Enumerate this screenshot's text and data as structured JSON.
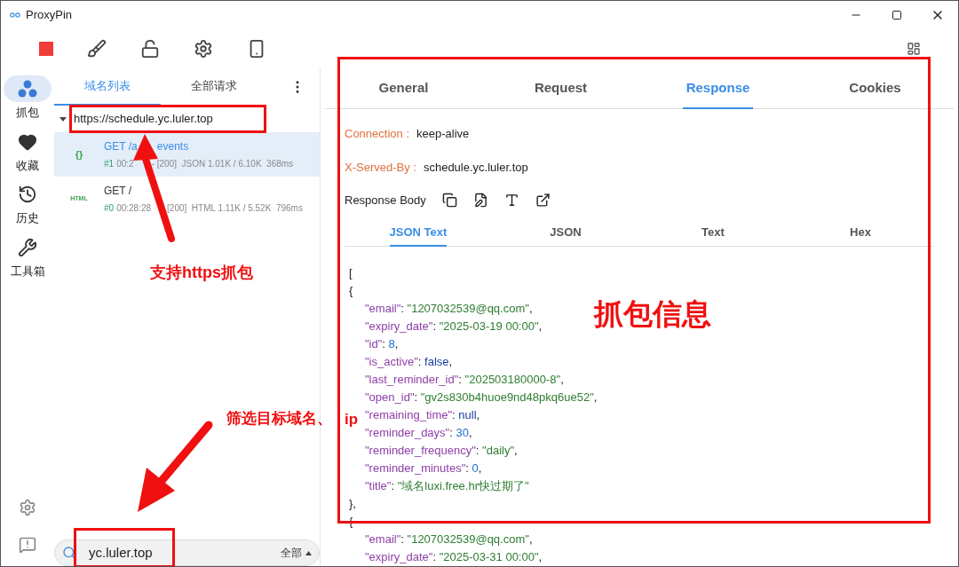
{
  "window": {
    "title": "ProxyPin"
  },
  "nav": [
    {
      "label": "抓包",
      "selected": true
    },
    {
      "label": "收藏",
      "selected": false
    },
    {
      "label": "历史",
      "selected": false
    },
    {
      "label": "工具箱",
      "selected": false
    }
  ],
  "list_tabs": [
    {
      "label": "域名列表",
      "selected": true
    },
    {
      "label": "全部请求",
      "selected": false
    }
  ],
  "domain": {
    "url": "https://schedule.yc.luler.top",
    "expanded": true
  },
  "requests": [
    {
      "kind": "json",
      "icon_text": "{}",
      "title": [
        "GET /a",
        "events"
      ],
      "number": "#1",
      "meta": [
        "00:2",
        "- [200]  JSON 1.01K / 6.10K  368ms"
      ],
      "selected": true
    },
    {
      "kind": "html",
      "icon_text": "HTML",
      "title": [
        "GET /"
      ],
      "number": "#0",
      "meta": [
        "00:28:28",
        "[200]  HTML 1.11K / 5.52K  796ms"
      ],
      "selected": false
    }
  ],
  "search": {
    "value": "yc.luler.top",
    "filter": "全部"
  },
  "detail_tabs": [
    {
      "label": "General",
      "selected": false
    },
    {
      "label": "Request",
      "selected": false
    },
    {
      "label": "Response",
      "selected": true
    },
    {
      "label": "Cookies",
      "selected": false
    }
  ],
  "headers": [
    {
      "name": "Connection :",
      "value": "keep-alive"
    },
    {
      "name": "X-Served-By :",
      "value": "schedule.yc.luler.top"
    }
  ],
  "body_label": "Response Body",
  "body_tabs": [
    {
      "label": "JSON Text",
      "selected": true
    },
    {
      "label": "JSON",
      "selected": false
    },
    {
      "label": "Text",
      "selected": false
    },
    {
      "label": "Hex",
      "selected": false
    }
  ],
  "body": {
    "open": "[",
    "children": [
      {
        "open": "{",
        "close": "},",
        "entries": [
          {
            "key": "\"email\"",
            "colon": ": ",
            "value": "\"1207032539@qq.com\"",
            "kind": "string",
            "comma": ","
          },
          {
            "key": "\"expiry_date\"",
            "colon": ": ",
            "value": "\"2025-03-19 00:00\"",
            "kind": "string",
            "comma": ","
          },
          {
            "key": "\"id\"",
            "colon": ": ",
            "value": "8",
            "kind": "number",
            "comma": ","
          },
          {
            "key": "\"is_active\"",
            "colon": ": ",
            "value": "false",
            "kind": "literal",
            "comma": ","
          },
          {
            "key": "\"last_reminder_id\"",
            "colon": ": ",
            "value": "\"202503180000-8\"",
            "kind": "string",
            "comma": ","
          },
          {
            "key": "\"open_id\"",
            "colon": ": ",
            "value": "\"gv2s830b4huoe9nd48pkq6ue52\"",
            "kind": "string",
            "comma": ","
          },
          {
            "key": "\"remaining_time\"",
            "colon": ": ",
            "value": "null",
            "kind": "literal",
            "comma": ","
          },
          {
            "key": "\"reminder_days\"",
            "colon": ": ",
            "value": "30",
            "kind": "number",
            "comma": ","
          },
          {
            "key": "\"reminder_frequency\"",
            "colon": ": ",
            "value": "\"daily\"",
            "kind": "string",
            "comma": ","
          },
          {
            "key": "\"reminder_minutes\"",
            "colon": ": ",
            "value": "0",
            "kind": "number",
            "comma": ","
          },
          {
            "key": "\"title\"",
            "colon": ": ",
            "value": "\"域名luxi.free.hr快过期了\"",
            "kind": "string"
          }
        ]
      },
      {
        "open": "{",
        "entries": [
          {
            "key": "\"email\"",
            "colon": ": ",
            "value": "\"1207032539@qq.com\"",
            "kind": "string",
            "comma": ","
          },
          {
            "key": "\"expiry_date\"",
            "colon": ": ",
            "value": "\"2025-03-31 00:00\"",
            "kind": "string",
            "comma": ","
          }
        ]
      }
    ]
  },
  "annotations": [
    {
      "text": "支持https抓包"
    },
    {
      "text": "筛选目标域名、"
    },
    {
      "text": "抓包信息"
    },
    {
      "text": "ip"
    }
  ]
}
